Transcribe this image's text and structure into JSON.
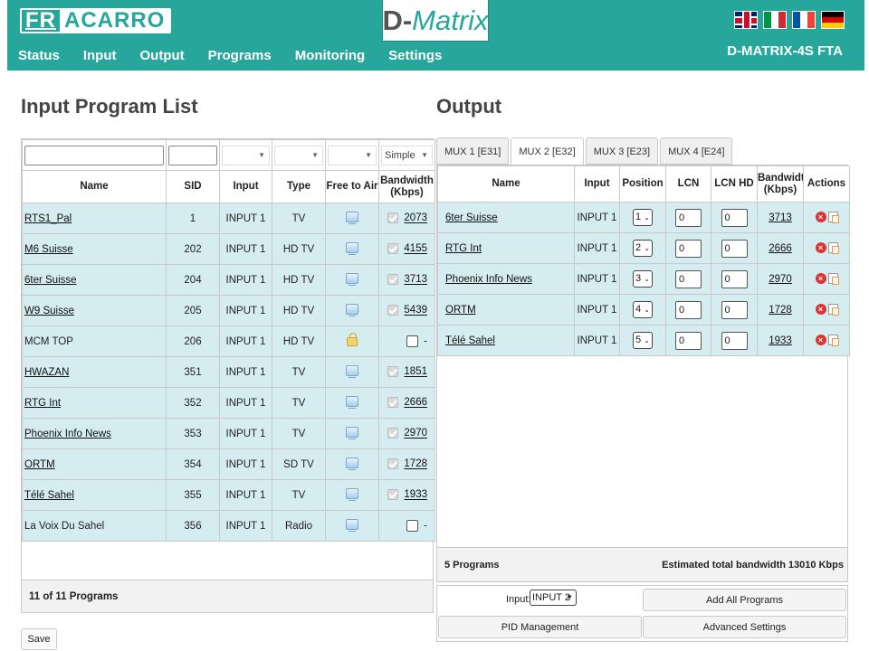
{
  "header": {
    "logo_fr": "FR",
    "logo_rest": "ACARRO",
    "brand_d": "D-",
    "brand_m": "Matrix",
    "model": "D-MATRIX-4S FTA",
    "nav": [
      "Status",
      "Input",
      "Output",
      "Programs",
      "Monitoring",
      "Settings"
    ],
    "flags": [
      "uk",
      "it",
      "fr",
      "de"
    ]
  },
  "left": {
    "title": "Input Program List",
    "filter_mode": "Simple",
    "columns": [
      "Name",
      "SID",
      "Input",
      "Type",
      "Free to Air",
      "Bandwidth (Kbps)"
    ],
    "programs": [
      {
        "name": "RTS1_Pal",
        "sid": "1",
        "input": "INPUT 1",
        "type": "TV",
        "icon": "tv",
        "checked": true,
        "bw": "2073"
      },
      {
        "name": "M6 Suisse",
        "sid": "202",
        "input": "INPUT 1",
        "type": "HD TV",
        "icon": "tv",
        "checked": true,
        "bw": "4155"
      },
      {
        "name": "6ter Suisse",
        "sid": "204",
        "input": "INPUT 1",
        "type": "HD TV",
        "icon": "tv",
        "checked": true,
        "bw": "3713"
      },
      {
        "name": "W9 Suisse",
        "sid": "205",
        "input": "INPUT 1",
        "type": "HD TV",
        "icon": "tv",
        "checked": true,
        "bw": "5439"
      },
      {
        "name": "MCM TOP",
        "sid": "206",
        "input": "INPUT 1",
        "type": "HD TV",
        "icon": "lock",
        "checked": false,
        "bw": "-"
      },
      {
        "name": "HWAZAN",
        "sid": "351",
        "input": "INPUT 1",
        "type": "TV",
        "icon": "tv",
        "checked": true,
        "bw": "1851"
      },
      {
        "name": "RTG Int",
        "sid": "352",
        "input": "INPUT 1",
        "type": "TV",
        "icon": "tv",
        "checked": true,
        "bw": "2666"
      },
      {
        "name": "Phoenix Info News",
        "sid": "353",
        "input": "INPUT 1",
        "type": "TV",
        "icon": "tv",
        "checked": true,
        "bw": "2970"
      },
      {
        "name": "ORTM",
        "sid": "354",
        "input": "INPUT 1",
        "type": "SD TV",
        "icon": "tv",
        "checked": true,
        "bw": "1728"
      },
      {
        "name": "Télé Sahel",
        "sid": "355",
        "input": "INPUT 1",
        "type": "TV",
        "icon": "tv",
        "checked": true,
        "bw": "1933"
      },
      {
        "name": "La Voix Du Sahel",
        "sid": "356",
        "input": "INPUT 1",
        "type": "Radio",
        "icon": "tv",
        "checked": false,
        "bw": "-"
      }
    ],
    "footer": "11 of 11 Programs",
    "save_label": "Save"
  },
  "right": {
    "title": "Output",
    "tabs": [
      "MUX 1 [E31]",
      "MUX 2 [E32]",
      "MUX 3 [E23]",
      "MUX 4 [E24]"
    ],
    "active_tab": 1,
    "columns": [
      "Name",
      "Input",
      "Position",
      "LCN",
      "LCN HD",
      "Bandwidth (Kbps)",
      "Actions"
    ],
    "programs": [
      {
        "name": "6ter Suisse",
        "input": "INPUT 1",
        "position": "1",
        "lcn": "0",
        "lcn_hd": "0",
        "bw": "3713"
      },
      {
        "name": "RTG Int",
        "input": "INPUT 1",
        "position": "2",
        "lcn": "0",
        "lcn_hd": "0",
        "bw": "2666"
      },
      {
        "name": "Phoenix Info News",
        "input": "INPUT 1",
        "position": "3",
        "lcn": "0",
        "lcn_hd": "0",
        "bw": "2970"
      },
      {
        "name": "ORTM",
        "input": "INPUT 1",
        "position": "4",
        "lcn": "0",
        "lcn_hd": "0",
        "bw": "1728"
      },
      {
        "name": "Télé Sahel",
        "input": "INPUT 1",
        "position": "5",
        "lcn": "0",
        "lcn_hd": "0",
        "bw": "1933"
      }
    ],
    "footer_programs": "5 Programs",
    "footer_est_label": "Estimated total bandwidth",
    "footer_total": "13010 Kbps",
    "input_label": "Input:",
    "input_value": "INPUT 2",
    "add_all_label": "Add All Programs",
    "pid_label": "PID Management",
    "advanced_label": "Advanced Settings"
  },
  "colors": {
    "header_bg": "#27a79c",
    "row_bg": "#d5ecf0"
  }
}
